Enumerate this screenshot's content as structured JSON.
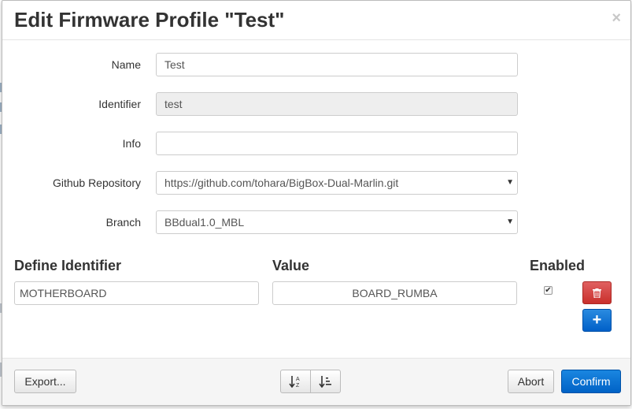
{
  "dialog": {
    "title": "Edit Firmware Profile \"Test\"",
    "close_symbol": "×"
  },
  "form": {
    "name": {
      "label": "Name",
      "value": "Test"
    },
    "identifier": {
      "label": "Identifier",
      "value": "test"
    },
    "info": {
      "label": "Info",
      "value": ""
    },
    "repository": {
      "label": "Github Repository",
      "value": "https://github.com/tohara/BigBox-Dual-Marlin.git"
    },
    "branch": {
      "label": "Branch",
      "value": "BBdual1.0_MBL"
    }
  },
  "defines": {
    "headers": {
      "identifier": "Define Identifier",
      "value": "Value",
      "enabled": "Enabled"
    },
    "rows": [
      {
        "identifier": "MOTHERBOARD",
        "value": "BOARD_RUMBA",
        "enabled": true
      }
    ]
  },
  "footer": {
    "export_label": "Export...",
    "sort_alpha_icon": "sort-alpha-icon",
    "sort_order_icon": "sort-order-icon",
    "abort_label": "Abort",
    "confirm_label": "Confirm"
  },
  "colors": {
    "primary": "#0062c6",
    "danger": "#c9302c"
  }
}
